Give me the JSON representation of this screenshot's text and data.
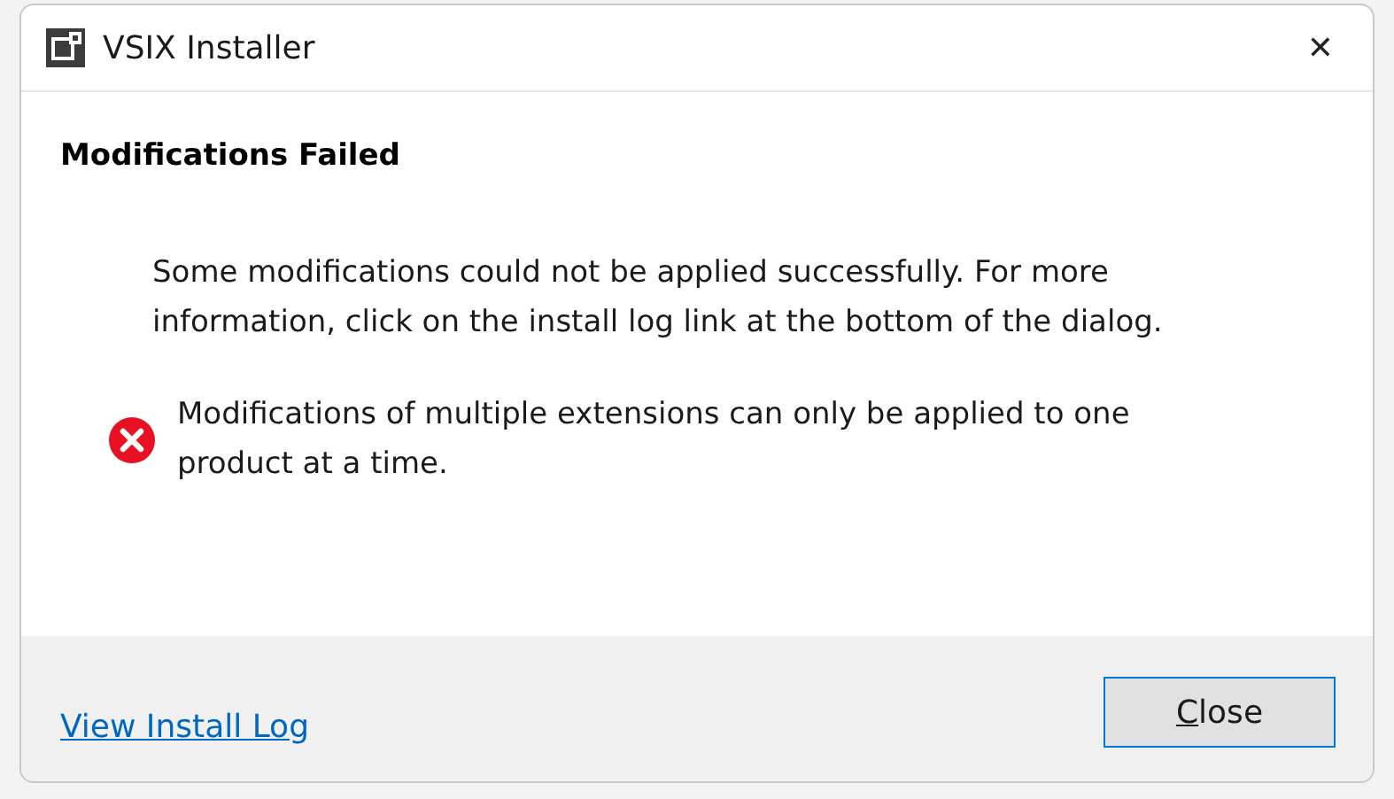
{
  "window": {
    "title": "VSIX Installer",
    "close_glyph": "✕"
  },
  "heading": "Modifications Failed",
  "message": "Some modifications could not be applied successfully. For more information, click on the install log link at the bottom of the dialog.",
  "errors": [
    "Modifications of multiple extensions can only be applied to one product at a time."
  ],
  "footer": {
    "link": "View Install Log",
    "button": {
      "label": "Close",
      "access_key_underlined": true,
      "focused": true
    }
  }
}
